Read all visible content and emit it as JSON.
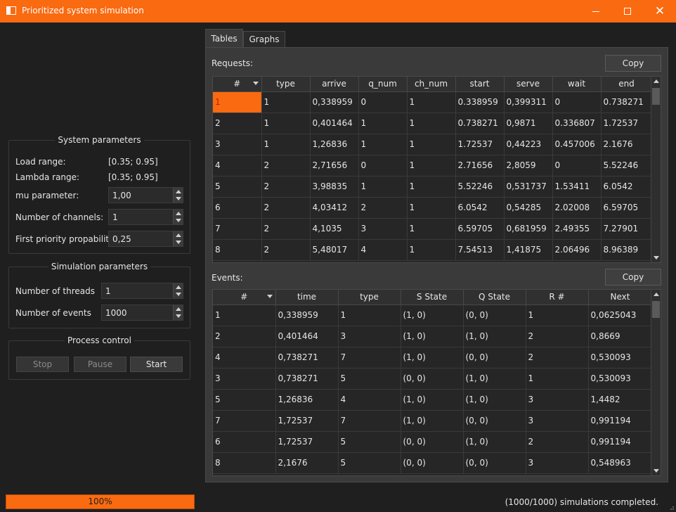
{
  "window": {
    "title": "Prioritized system simulation"
  },
  "system_params": {
    "title": "System parameters",
    "load_range_label": "Load range:",
    "load_range_value": "[0.35;  0.95]",
    "lambda_range_label": "Lambda range:",
    "lambda_range_value": "[0.35;  0.95]",
    "mu_label": "mu parameter:",
    "mu_value": "1,00",
    "channels_label": "Number of channels:",
    "channels_value": "1",
    "priority_label": "First priority propability:",
    "priority_value": "0,25"
  },
  "sim_params": {
    "title": "Simulation parameters",
    "threads_label": "Number of threads",
    "threads_value": "1",
    "events_label": "Number of events",
    "events_value": "1000"
  },
  "process_control": {
    "title": "Process control",
    "stop_label": "Stop",
    "pause_label": "Pause",
    "start_label": "Start"
  },
  "tabs": [
    {
      "label": "Tables"
    },
    {
      "label": "Graphs"
    }
  ],
  "requests": {
    "label": "Requests:",
    "copy_label": "Copy",
    "columns": [
      "#",
      "type",
      "arrive",
      "q_num",
      "ch_num",
      "start",
      "serve",
      "wait",
      "end"
    ],
    "rows": [
      [
        "1",
        "1",
        "0,338959",
        "0",
        "1",
        "0.338959",
        "0,399311",
        "0",
        "0.738271"
      ],
      [
        "2",
        "1",
        "0,401464",
        "1",
        "1",
        "0.738271",
        "0,9871",
        "0.336807",
        "1.72537"
      ],
      [
        "3",
        "1",
        "1,26836",
        "1",
        "1",
        "1.72537",
        "0,44223",
        "0.457006",
        "2.1676"
      ],
      [
        "4",
        "2",
        "2,71656",
        "0",
        "1",
        "2.71656",
        "2,8059",
        "0",
        "5.52246"
      ],
      [
        "5",
        "2",
        "3,98835",
        "1",
        "1",
        "5.52246",
        "0,531737",
        "1.53411",
        "6.0542"
      ],
      [
        "6",
        "2",
        "4,03412",
        "2",
        "1",
        "6.0542",
        "0,54285",
        "2.02008",
        "6.59705"
      ],
      [
        "7",
        "2",
        "4,1035",
        "3",
        "1",
        "6.59705",
        "0,681959",
        "2.49355",
        "7.27901"
      ],
      [
        "8",
        "2",
        "5,48017",
        "4",
        "1",
        "7.54513",
        "1,41875",
        "2.06496",
        "8.96389"
      ]
    ]
  },
  "events": {
    "label": "Events:",
    "copy_label": "Copy",
    "columns": [
      "#",
      "time",
      "type",
      "S State",
      "Q State",
      "R #",
      "Next"
    ],
    "rows": [
      [
        "1",
        "0,338959",
        "1",
        "(1, 0)",
        "(0, 0)",
        "1",
        "0,0625043"
      ],
      [
        "2",
        "0,401464",
        "3",
        "(1, 0)",
        "(1, 0)",
        "2",
        "0,8669"
      ],
      [
        "4",
        "0,738271",
        "7",
        "(1, 0)",
        "(0, 0)",
        "2",
        "0,530093"
      ],
      [
        "3",
        "0,738271",
        "5",
        "(0, 0)",
        "(1, 0)",
        "1",
        "0,530093"
      ],
      [
        "5",
        "1,26836",
        "4",
        "(1, 0)",
        "(1, 0)",
        "3",
        "1,4482"
      ],
      [
        "7",
        "1,72537",
        "7",
        "(1, 0)",
        "(0, 0)",
        "3",
        "0,991194"
      ],
      [
        "6",
        "1,72537",
        "5",
        "(0, 0)",
        "(1, 0)",
        "2",
        "0,991194"
      ],
      [
        "8",
        "2,1676",
        "5",
        "(0, 0)",
        "(0, 0)",
        "3",
        "0,548963"
      ]
    ]
  },
  "status": {
    "progress_label": "100%",
    "progress_value": 1.0,
    "message": "(1000/1000) simulations completed."
  },
  "colors": {
    "accent": "#fa6a10",
    "background": "#1f1f1f",
    "panel": "#3a3a3a"
  }
}
